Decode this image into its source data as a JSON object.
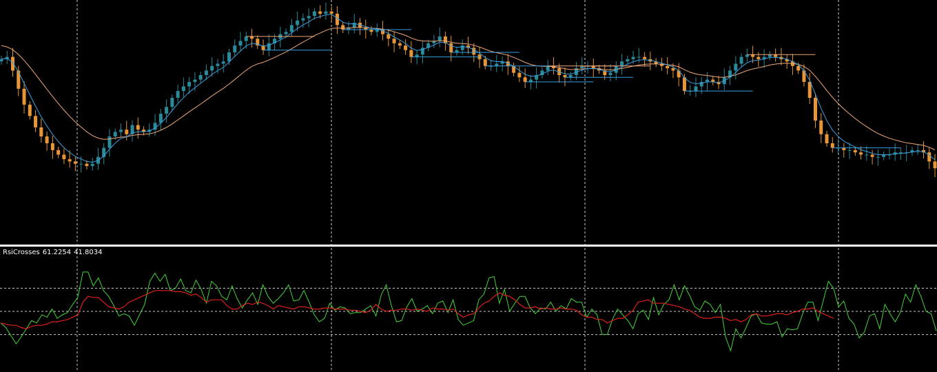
{
  "colors": {
    "background": "#000000",
    "bull": "#2a8a9a",
    "bear": "#e69638",
    "slow_ma": "#f0a878",
    "fast_ma": "#3aa0e0",
    "rsi_fast": "#44d43a",
    "rsi_slow": "#e0201a",
    "grid": "#ffffff",
    "separator": "#ffffff"
  },
  "indicator": {
    "name": "RsiCrosses",
    "value1": "61.2254",
    "value2": "41.8034"
  },
  "chart_data": [
    {
      "type": "candlestick",
      "title": "",
      "grid": true,
      "series": [
        {
          "name": "price",
          "values": [
            77,
            78,
            72,
            64,
            57,
            52,
            47,
            43,
            40,
            37,
            35,
            33,
            32,
            31,
            31,
            30,
            31,
            34,
            38,
            43,
            45,
            46,
            44,
            48,
            46,
            45,
            46,
            49,
            53,
            56,
            60,
            63,
            65,
            67,
            68,
            70,
            72,
            74,
            75,
            76,
            80,
            83,
            85,
            87,
            86,
            83,
            81,
            84,
            86,
            88,
            89,
            92,
            94,
            95,
            96,
            98,
            97,
            98,
            97,
            92,
            90,
            91,
            93,
            91,
            90,
            89,
            90,
            88,
            86,
            84,
            83,
            81,
            78,
            79,
            82,
            84,
            85,
            87,
            84,
            80,
            81,
            83,
            82,
            79,
            77,
            74,
            74,
            75,
            76,
            74,
            71,
            69,
            67,
            68,
            70,
            72,
            74,
            73,
            70,
            69,
            70,
            73,
            74,
            74,
            73,
            72,
            70,
            71,
            74,
            76,
            77,
            78,
            78,
            77,
            76,
            75,
            74,
            73,
            72,
            69,
            63,
            63,
            65,
            67,
            68,
            67,
            66,
            69,
            72,
            75,
            78,
            79,
            78,
            77,
            78,
            79,
            78,
            77,
            76,
            74,
            72,
            67,
            60,
            50,
            44,
            40,
            38,
            38,
            37,
            37,
            36,
            35,
            35,
            34,
            34,
            35,
            35,
            36,
            36,
            36,
            37,
            37,
            36,
            32,
            29
          ]
        }
      ]
    },
    {
      "type": "line",
      "title": "RsiCrosses",
      "ylim": [
        0,
        100
      ],
      "levels": [
        70,
        50,
        30
      ],
      "series": [
        {
          "name": "fast",
          "values": [
            40,
            36,
            29,
            22,
            28,
            35,
            42,
            40,
            47,
            45,
            52,
            44,
            47,
            49,
            56,
            62,
            84,
            84,
            72,
            79,
            68,
            63,
            55,
            46,
            48,
            46,
            38,
            47,
            56,
            76,
            83,
            76,
            82,
            68,
            70,
            78,
            68,
            66,
            77,
            69,
            57,
            76,
            72,
            63,
            60,
            72,
            61,
            53,
            60,
            66,
            56,
            73,
            63,
            57,
            61,
            66,
            73,
            59,
            60,
            68,
            58,
            47,
            41,
            44,
            57,
            51,
            54,
            53,
            48,
            49,
            49,
            52,
            55,
            46,
            64,
            73,
            55,
            41,
            42,
            54,
            61,
            50,
            52,
            55,
            48,
            57,
            59,
            49,
            60,
            43,
            38,
            40,
            42,
            60,
            65,
            79,
            80,
            57,
            69,
            50,
            57,
            63,
            63,
            53,
            48,
            53,
            52,
            58,
            50,
            55,
            52,
            61,
            58,
            58,
            45,
            52,
            47,
            30,
            30,
            43,
            52,
            47,
            42,
            35,
            48,
            51,
            43,
            62,
            47,
            56,
            60,
            73,
            60,
            72,
            64,
            54,
            51,
            59,
            56,
            49,
            56,
            28,
            16,
            35,
            27,
            36,
            46,
            48,
            40,
            39,
            39,
            41,
            28,
            35,
            34,
            35,
            48,
            58,
            58,
            42,
            59,
            76,
            70,
            54,
            59,
            44,
            39,
            27,
            32,
            46,
            48,
            35,
            56,
            48,
            41,
            49,
            65,
            58,
            73,
            63,
            50,
            48,
            33
          ]
        },
        {
          "name": "slow",
          "values": [
            40,
            39,
            38,
            38,
            36,
            35,
            37,
            38,
            38,
            39,
            41,
            41,
            42,
            43,
            45,
            47,
            58,
            63,
            62,
            62,
            58,
            54,
            53,
            52,
            54,
            58,
            60,
            62,
            64,
            66,
            68,
            68,
            68,
            68,
            67,
            67,
            66,
            64,
            65,
            62,
            58,
            60,
            60,
            60,
            55,
            52,
            52,
            55,
            57,
            56,
            58,
            57,
            55,
            52,
            55,
            54,
            53,
            52,
            54,
            54,
            53,
            52,
            52,
            53,
            53,
            52,
            52,
            52,
            51,
            51,
            50,
            49,
            51,
            56,
            52,
            50,
            51,
            51,
            52,
            52,
            51,
            52,
            51,
            50,
            53,
            52,
            52,
            51,
            52,
            48,
            45,
            47,
            48,
            53,
            57,
            59,
            63,
            66,
            64,
            63,
            60,
            56,
            53,
            53,
            54,
            52,
            53,
            52,
            52,
            53,
            52,
            52,
            51,
            47,
            45,
            45,
            43,
            43,
            40,
            42,
            44,
            44,
            47,
            51,
            58,
            59,
            60,
            57,
            57,
            57,
            56,
            55,
            54,
            52,
            51,
            48,
            45,
            44,
            44,
            45,
            45,
            44,
            42,
            43,
            41,
            43,
            47,
            48,
            46,
            46,
            47,
            48,
            48,
            47,
            49,
            50,
            52,
            52,
            53,
            50,
            48,
            46,
            44
          ]
        }
      ]
    }
  ]
}
